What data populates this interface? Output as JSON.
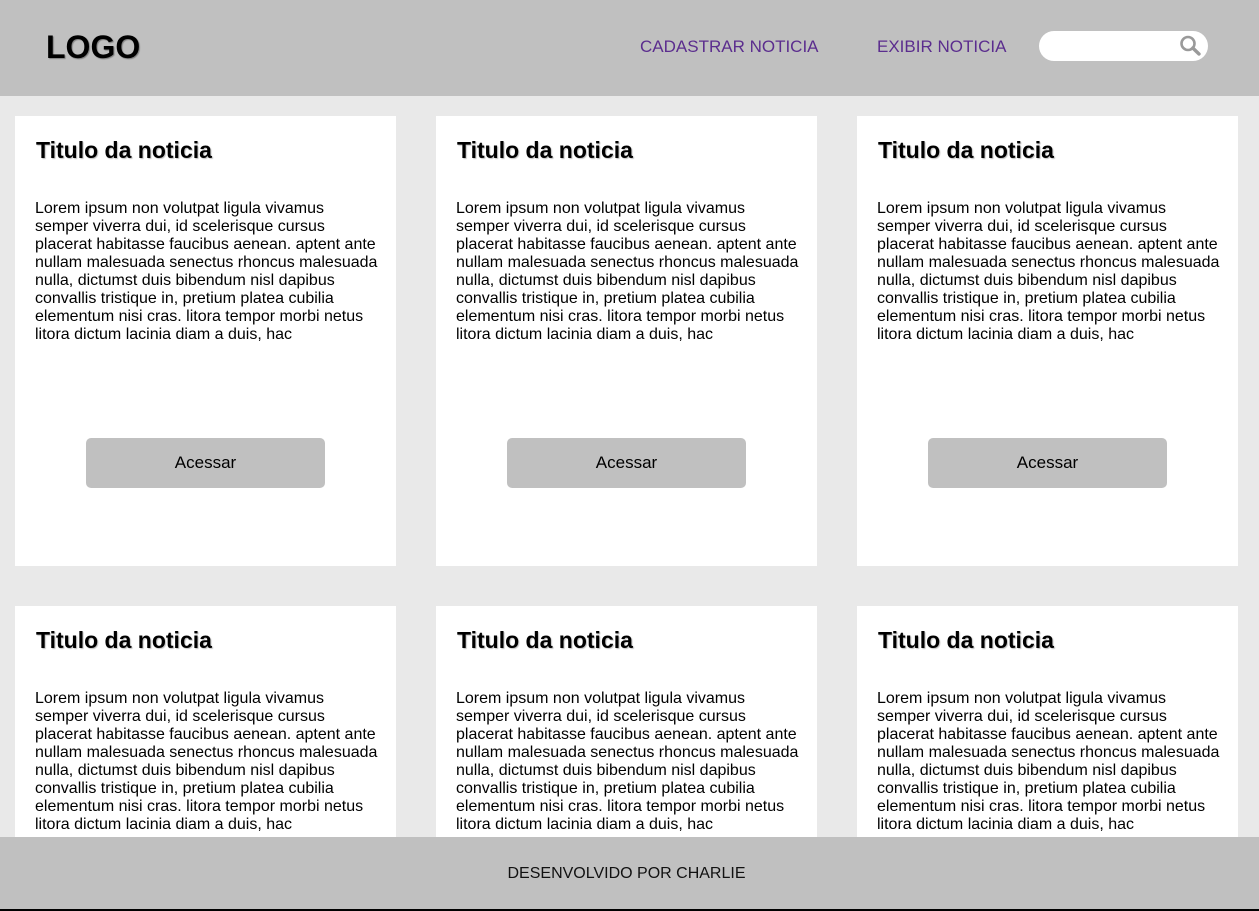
{
  "header": {
    "logo": "LOGO",
    "nav": [
      {
        "label": "CADASTRAR NOTICIA"
      },
      {
        "label": "EXIBIR NOTICIA"
      }
    ],
    "search": {
      "value": "",
      "placeholder": "",
      "icon": "search-icon"
    }
  },
  "colors": {
    "header_bg": "#c0c0c0",
    "page_bg": "#e9e9e9",
    "nav_link": "#5b2d8e",
    "button_bg": "#c0c0c0"
  },
  "cards": [
    {
      "title": "Titulo da noticia",
      "body": "Lorem ipsum non volutpat ligula vivamus semper viverra dui, id scelerisque cursus placerat habitasse faucibus aenean. aptent ante nullam malesuada senectus rhoncus malesuada nulla, dictumst duis bibendum nisl dapibus convallis tristique in, pretium platea cubilia elementum nisi cras. litora tempor morbi netus litora dictum lacinia diam a duis, hac",
      "button": "Acessar"
    },
    {
      "title": "Titulo da noticia",
      "body": "Lorem ipsum non volutpat ligula vivamus semper viverra dui, id scelerisque cursus placerat habitasse faucibus aenean. aptent ante nullam malesuada senectus rhoncus malesuada nulla, dictumst duis bibendum nisl dapibus convallis tristique in, pretium platea cubilia elementum nisi cras. litora tempor morbi netus litora dictum lacinia diam a duis, hac",
      "button": "Acessar"
    },
    {
      "title": "Titulo da noticia",
      "body": "Lorem ipsum non volutpat ligula vivamus semper viverra dui, id scelerisque cursus placerat habitasse faucibus aenean. aptent ante nullam malesuada senectus rhoncus malesuada nulla, dictumst duis bibendum nisl dapibus convallis tristique in, pretium platea cubilia elementum nisi cras. litora tempor morbi netus litora dictum lacinia diam a duis, hac",
      "button": "Acessar"
    },
    {
      "title": "Titulo da noticia",
      "body": "Lorem ipsum non volutpat ligula vivamus semper viverra dui, id scelerisque cursus placerat habitasse faucibus aenean. aptent ante nullam malesuada senectus rhoncus malesuada nulla, dictumst duis bibendum nisl dapibus convallis tristique in, pretium platea cubilia elementum nisi cras. litora tempor morbi netus litora dictum lacinia diam a duis, hac"
    },
    {
      "title": "Titulo da noticia",
      "body": "Lorem ipsum non volutpat ligula vivamus semper viverra dui, id scelerisque cursus placerat habitasse faucibus aenean. aptent ante nullam malesuada senectus rhoncus malesuada nulla, dictumst duis bibendum nisl dapibus convallis tristique in, pretium platea cubilia elementum nisi cras. litora tempor morbi netus litora dictum lacinia diam a duis, hac"
    },
    {
      "title": "Titulo da noticia",
      "body": "Lorem ipsum non volutpat ligula vivamus semper viverra dui, id scelerisque cursus placerat habitasse faucibus aenean. aptent ante nullam malesuada senectus rhoncus malesuada nulla, dictumst duis bibendum nisl dapibus convallis tristique in, pretium platea cubilia elementum nisi cras. litora tempor morbi netus litora dictum lacinia diam a duis, hac"
    }
  ],
  "footer": {
    "text": "DESENVOLVIDO POR CHARLIE"
  }
}
